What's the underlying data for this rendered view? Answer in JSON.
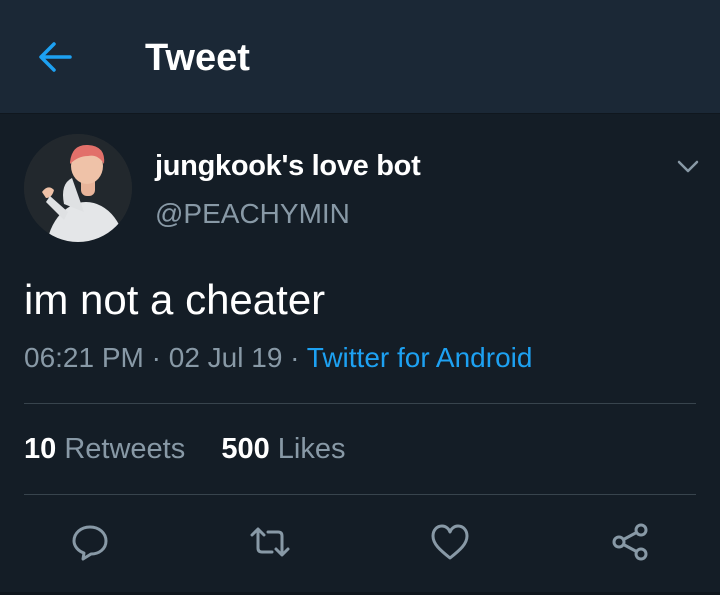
{
  "header": {
    "title": "Tweet",
    "back_icon": "arrow-left-icon"
  },
  "tweet": {
    "author": {
      "display_name": "jungkook's love bot",
      "handle": "@PEACHYMIN"
    },
    "text": "im not a cheater",
    "time": "06:21 PM",
    "date": "02 Jul 19",
    "separator": "·",
    "source": "Twitter for Android"
  },
  "stats": {
    "retweets_count": "10",
    "retweets_label": "Retweets",
    "likes_count": "500",
    "likes_label": "Likes"
  },
  "actions": {
    "reply_icon": "reply-icon",
    "retweet_icon": "retweet-icon",
    "like_icon": "heart-icon",
    "share_icon": "share-icon"
  },
  "colors": {
    "background": "#141d26",
    "header": "#1b2836",
    "accent": "#1da1f2",
    "secondary_text": "#8899a6",
    "divider": "#38444d"
  }
}
